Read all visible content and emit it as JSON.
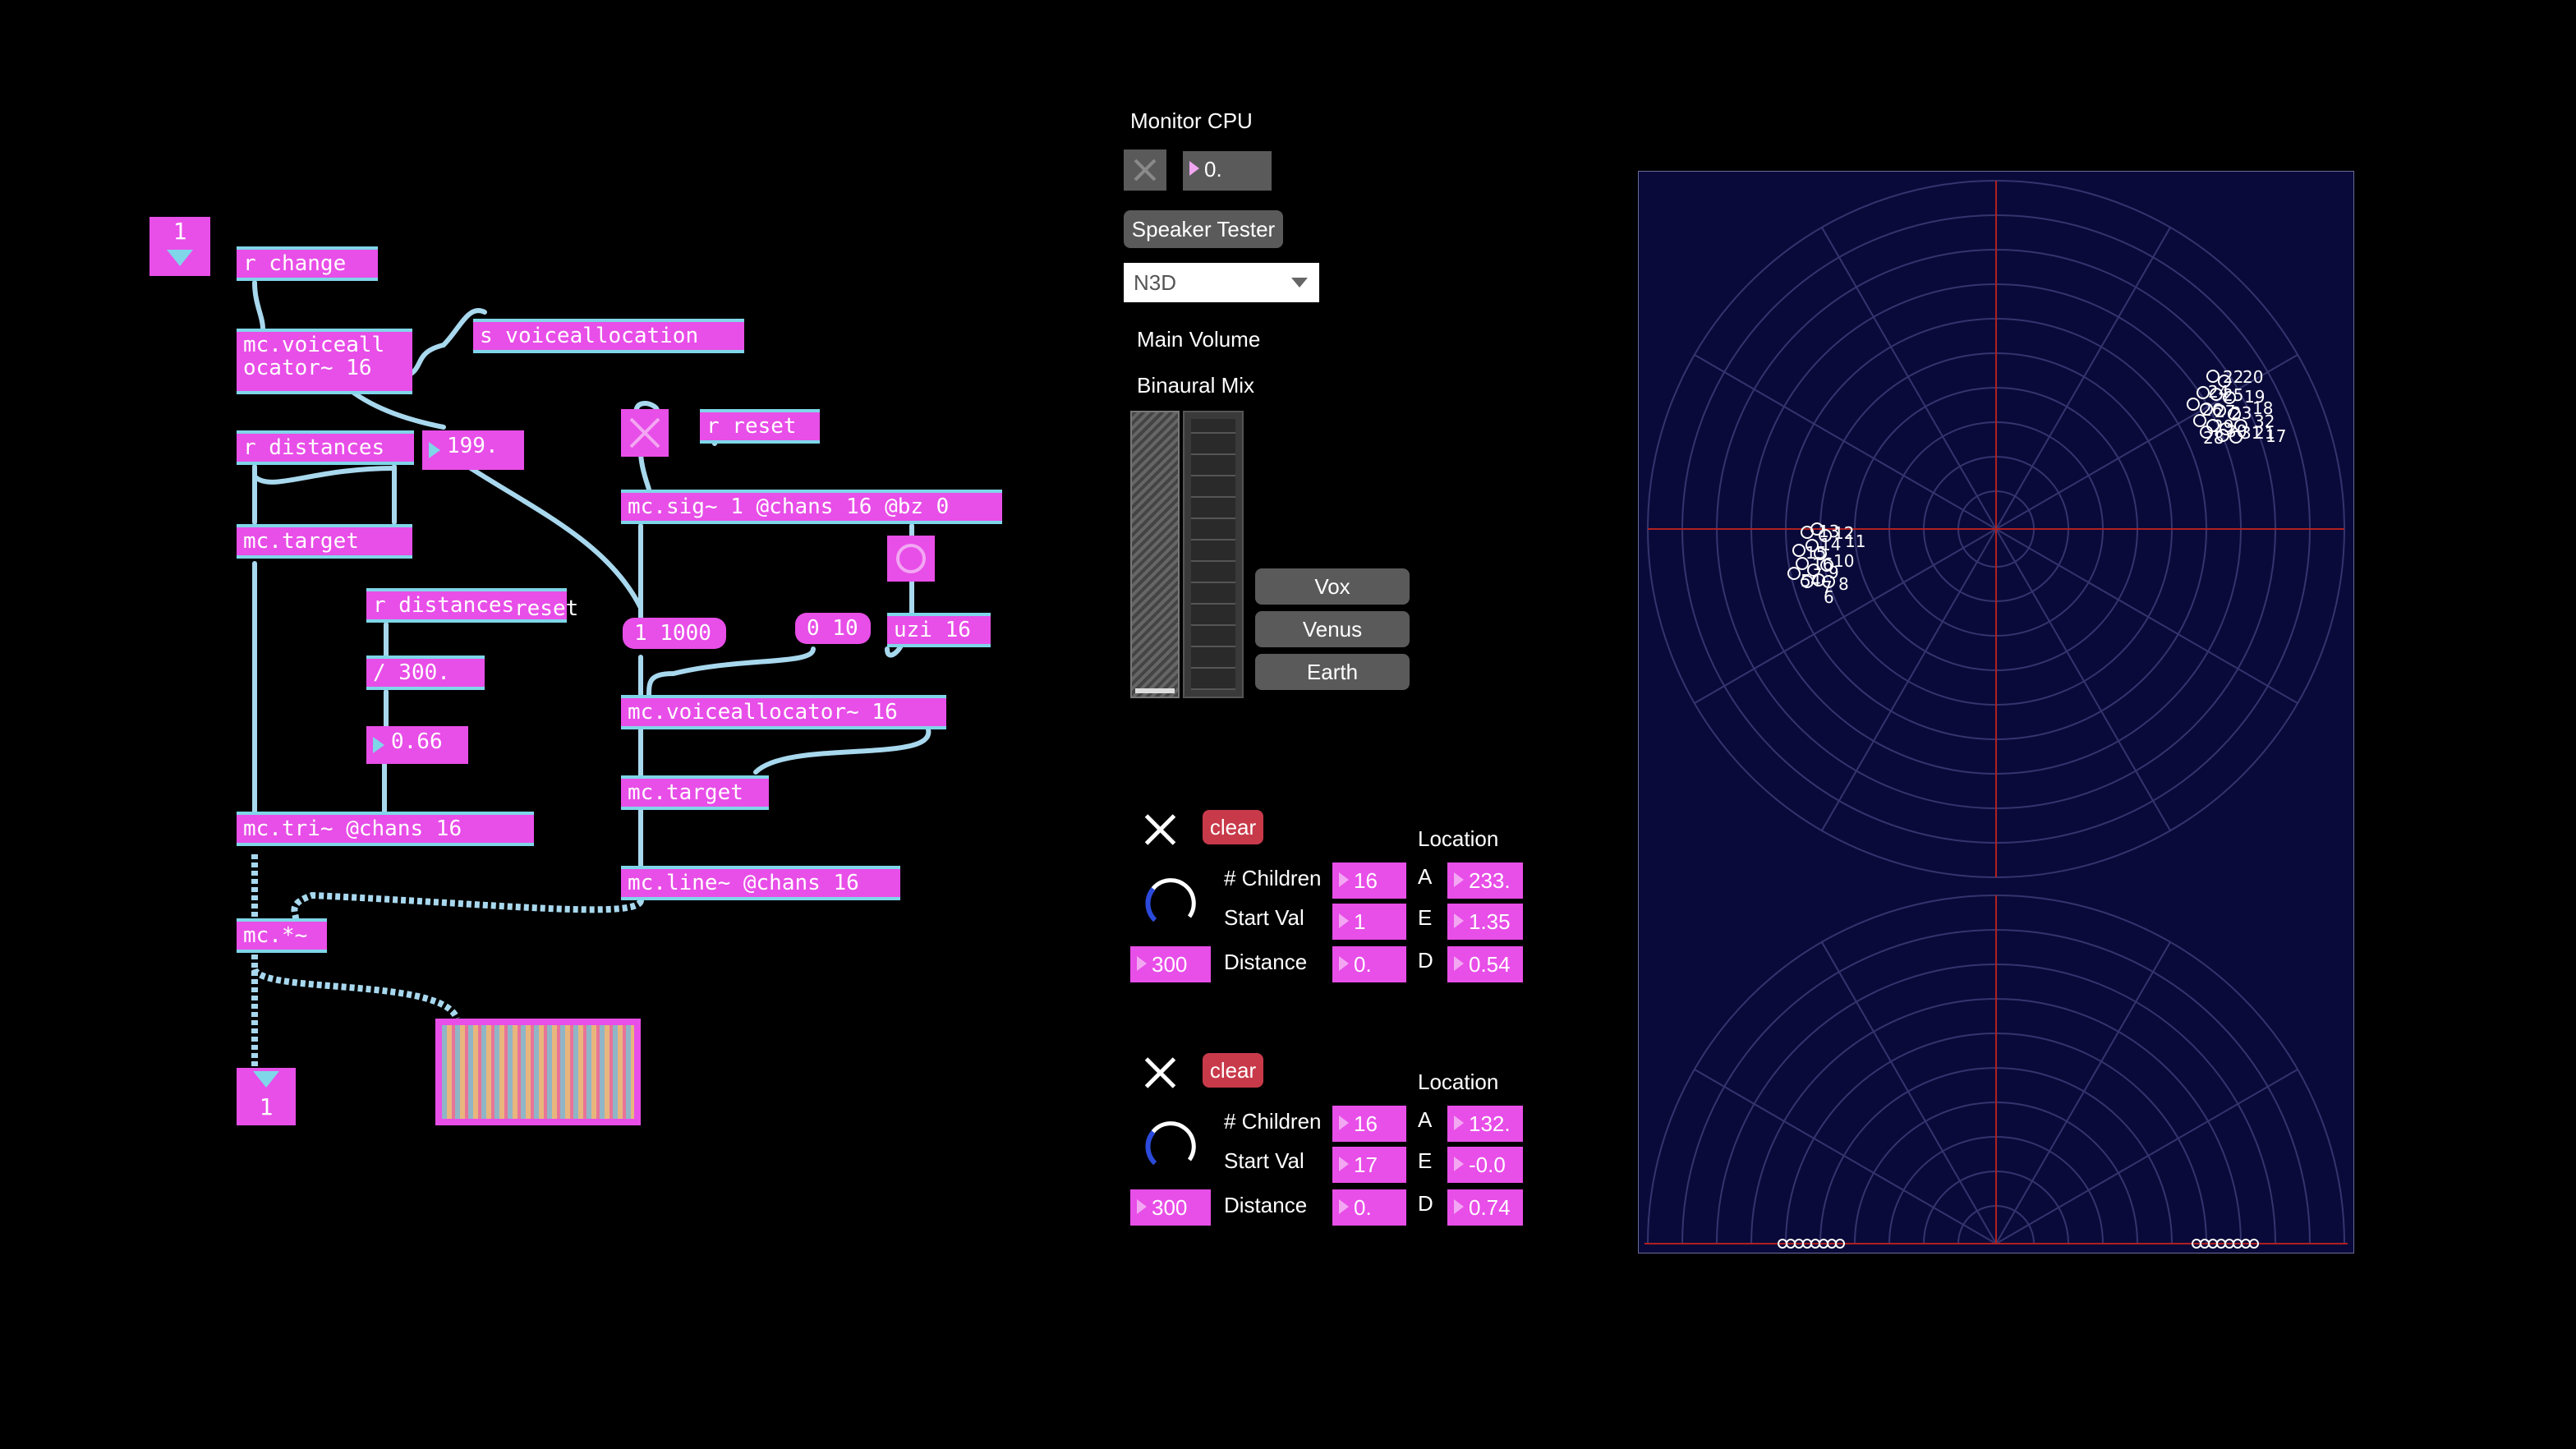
{
  "patch": {
    "inlet_number": "1",
    "outlet_number": "1",
    "objects": {
      "r_change": "r change",
      "s_voiceallocation": "s voiceallocation",
      "mc_voiceallocator_a": "mc.voiceall ocator~ 16",
      "r_distances": "r distances",
      "num_199": "199.",
      "mc_target_a": "mc.target",
      "r_distances_2": "r distances",
      "reset_overlap": "reset",
      "div_300": "/ 300.",
      "num_066": "0.66",
      "mc_tri": "mc.tri~ @chans 16",
      "mc_times": "mc.*~",
      "r_reset": "r reset",
      "mc_sig": "mc.sig~ 1 @chans 16 @bz 0",
      "msg_1_1000": "1 1000",
      "msg_0_10": "0 10",
      "uzi": "uzi 16",
      "mc_voiceallocator_b": "mc.voiceallocator~ 16",
      "mc_target_b": "mc.target",
      "mc_line": "mc.line~ @chans 16"
    }
  },
  "panel": {
    "monitor_cpu_label": "Monitor CPU",
    "cpu_value": "0.",
    "speaker_tester_label": "Speaker Tester",
    "decoder_select_value": "N3D",
    "main_volume_label": "Main Volume",
    "binaural_mix_label": "Binaural Mix",
    "presets": [
      "Vox",
      "Venus",
      "Earth"
    ],
    "sources": [
      {
        "clear_label": "clear",
        "location_label": "Location",
        "children_label": "# Children",
        "children_value": "16",
        "start_val_label": "Start Val",
        "start_val_value": "1",
        "distance_label": "Distance",
        "distance_value": "300",
        "distance_offset": "0.",
        "a_label": "A",
        "a_value": "233.",
        "e_label": "E",
        "e_value": "1.35",
        "d_label": "D",
        "d_value": "0.54"
      },
      {
        "clear_label": "clear",
        "location_label": "Location",
        "children_label": "# Children",
        "children_value": "16",
        "start_val_label": "Start Val",
        "start_val_value": "17",
        "distance_label": "Distance",
        "distance_value": "300",
        "distance_offset": "0.",
        "a_label": "A",
        "a_value": "132.",
        "e_label": "E",
        "e_value": "-0.0",
        "d_label": "D",
        "d_value": "0.74"
      }
    ]
  },
  "spat_view": {
    "background": "#0a0a3a",
    "grid_color": "#3a3a7a",
    "axis_color": "#b02020",
    "cluster_a_labels": [
      "13",
      "12",
      "14",
      "11",
      "15",
      "16",
      "10",
      "9",
      "5",
      "4",
      "8",
      "7",
      "6"
    ],
    "cluster_b_labels": [
      "22",
      "20",
      "24",
      "25",
      "19",
      "18",
      "26",
      "27",
      "23",
      "32",
      "29",
      "30",
      "31",
      "21",
      "28",
      "17"
    ]
  },
  "colors": {
    "object": "#e84ee8",
    "cable": "#a8d8ee",
    "ui_button": "#5a5a5a",
    "clear": "#c83a4a"
  }
}
